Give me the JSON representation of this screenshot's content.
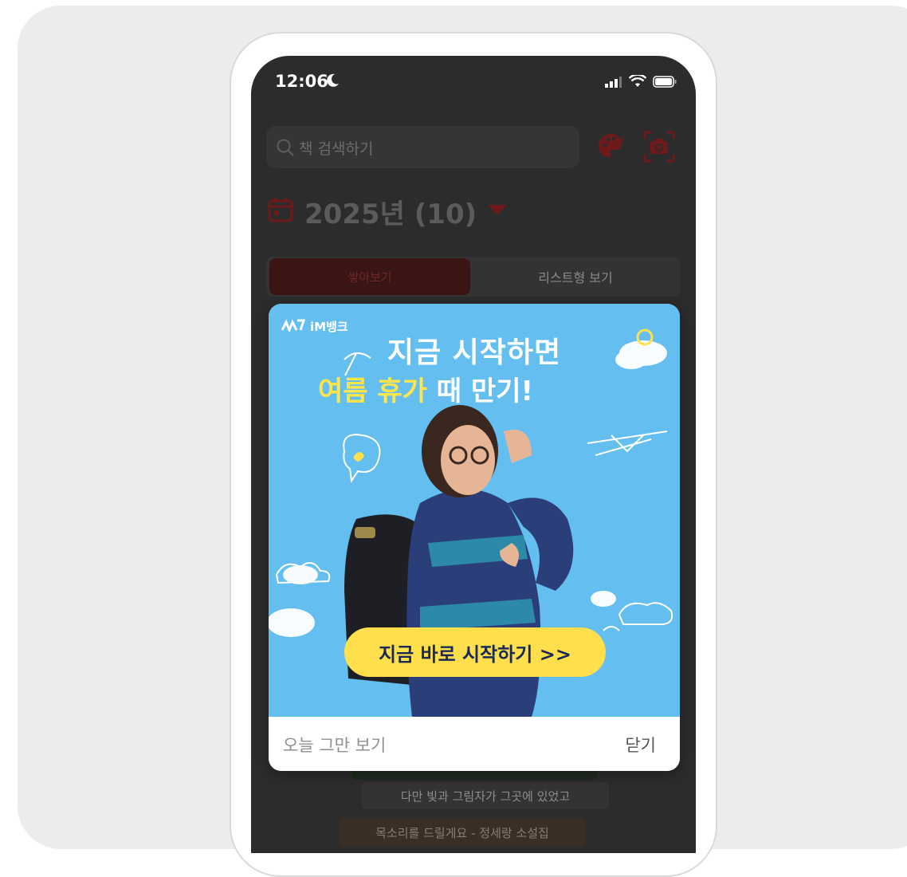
{
  "status_bar": {
    "time": "12:06"
  },
  "search": {
    "placeholder": "책 검색하기"
  },
  "header": {
    "year_label": "2025년 (10)"
  },
  "tabs": {
    "stack": "쌓아보기",
    "list": "리스트형 보기"
  },
  "books": [
    {
      "title": ""
    },
    {
      "title": "다만 빛과 그림자가 그곳에 있었고"
    },
    {
      "title": "목소리를 드릴게요 - 정세랑 소설집"
    }
  ],
  "popup": {
    "ad": {
      "brand": "iM뱅크",
      "headline_line1": "지금 시작하면",
      "headline_yellow": "여름 휴가",
      "headline_white": " 때 만기!",
      "cta": "지금 바로 시작하기  >>"
    },
    "dismiss_today": "오늘 그만 보기",
    "close": "닫기"
  },
  "colors": {
    "accent": "#7a1c1c",
    "ad_bg": "#64bff0",
    "cta": "#ffe04c"
  }
}
